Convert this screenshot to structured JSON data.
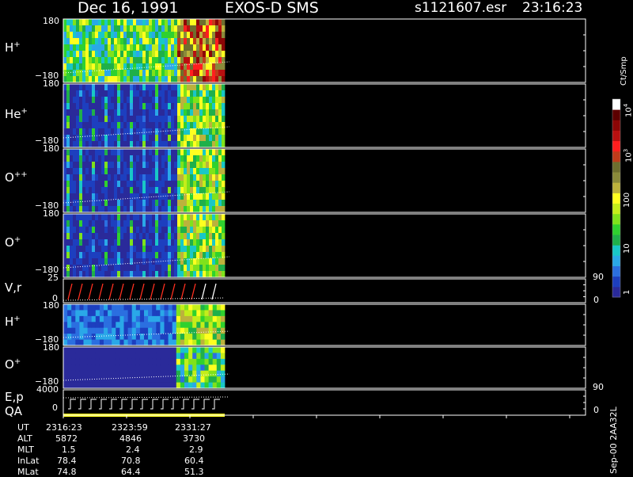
{
  "header": {
    "date": "Dec 16, 1991",
    "instrument": "EXOS-D SMS",
    "file": "s1121607.esr",
    "time": "23:16:23"
  },
  "colorbar": {
    "unit": "Ct/Smp",
    "labels": [
      "1",
      "10",
      "100",
      "10^3",
      "10^4"
    ],
    "colors": [
      "#2a2a9a",
      "#1d3fbf",
      "#2b6fe0",
      "#2aa8e8",
      "#19c7c7",
      "#1fb04a",
      "#2fd12f",
      "#7fe21b",
      "#c4ee1a",
      "#ffff20",
      "#bcb23c",
      "#8a8a3a",
      "#6e6e2e",
      "#c03b1a",
      "#ff1e1e",
      "#b81010",
      "#8c0606",
      "#5c0000",
      "#ffffff"
    ]
  },
  "panels": [
    {
      "id": "h-plus",
      "label": "H",
      "sup": "+",
      "top": "180",
      "bottom": "−180"
    },
    {
      "id": "he-plus",
      "label": "He",
      "sup": "+",
      "top": "180",
      "bottom": "−180"
    },
    {
      "id": "o-plusplus",
      "label": "O",
      "sup": "++",
      "top": "180",
      "bottom": "−180"
    },
    {
      "id": "o-plus",
      "label": "O",
      "sup": "+",
      "top": "180",
      "bottom": "−180"
    },
    {
      "id": "vr",
      "label": "V,r",
      "sup": "",
      "top": "25",
      "bottom": "0",
      "right_top": "90",
      "right_bottom": "0"
    },
    {
      "id": "h-plus-2",
      "label": "H",
      "sup": "+",
      "top": "180",
      "bottom": "−180"
    },
    {
      "id": "o-plus-2",
      "label": "O",
      "sup": "+",
      "top": "180",
      "bottom": "−180"
    },
    {
      "id": "ep",
      "label": "E,p",
      "sup": "",
      "top": "4000",
      "bottom": "0",
      "right_top": "90",
      "right_bottom": "0"
    }
  ],
  "qa_label": "QA",
  "footer": {
    "rows": [
      {
        "name": "UT",
        "values": [
          "2316:23",
          "2323:59",
          "2331:27"
        ]
      },
      {
        "name": "ALT",
        "values": [
          "5872",
          "4846",
          "3730"
        ]
      },
      {
        "name": "MLT",
        "values": [
          "1.5",
          "2.4",
          "2.9"
        ]
      },
      {
        "name": "InLat",
        "values": [
          "78.4",
          "70.8",
          "60.4"
        ]
      },
      {
        "name": "MLat",
        "values": [
          "74.8",
          "64.4",
          "51.3"
        ]
      }
    ],
    "code": "Sep-00 2AA32L"
  },
  "chart_data": {
    "type": "heatmap",
    "x_ticks_ut": [
      "2316:23",
      "2323:59",
      "2331:27"
    ],
    "y_range_pitch": [
      -180,
      180
    ],
    "vr_range": [
      0,
      25
    ],
    "ep_range": [
      0,
      4000
    ]
  }
}
